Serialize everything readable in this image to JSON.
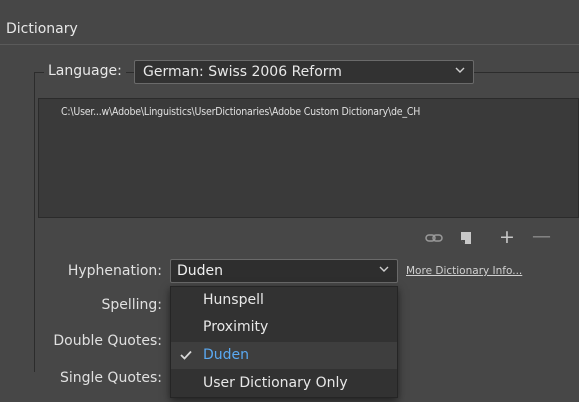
{
  "section": {
    "title": "Dictionary"
  },
  "language": {
    "label": "Language:",
    "value": "German: Swiss 2006 Reform"
  },
  "dictionary_list": {
    "items": [
      "C:\\User...w\\Adobe\\Linguistics\\UserDictionaries\\Adobe Custom Dictionary\\de_CH"
    ]
  },
  "toolbar": {
    "icons": [
      "link-icon",
      "new-page-icon",
      "plus-icon",
      "minus-icon"
    ],
    "plus_glyph": "+",
    "minus_glyph": "—"
  },
  "hyphenation": {
    "label": "Hyphenation:",
    "value": "Duden",
    "more_info_link": "More Dictionary Info...",
    "options": [
      "Hunspell",
      "Proximity",
      "Duden",
      "User Dictionary Only"
    ],
    "selected_index": 2
  },
  "spelling": {
    "label": "Spelling:"
  },
  "double_quotes": {
    "label": "Double Quotes:"
  },
  "single_quotes": {
    "label": "Single Quotes:"
  },
  "colors": {
    "background": "#474747",
    "field": "#323232",
    "selected_text": "#5aa9f2"
  }
}
